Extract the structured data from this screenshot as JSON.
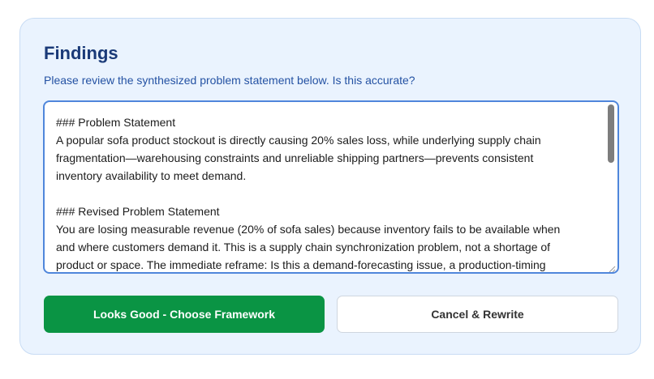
{
  "findings": {
    "title": "Findings",
    "subtitle": "Please review the synthesized problem statement below. Is this accurate?",
    "statement_lines": [
      "### Problem Statement",
      "A popular sofa product stockout is directly causing 20% sales loss, while underlying supply chain",
      "fragmentation—warehousing constraints and unreliable shipping partners—prevents consistent",
      "inventory availability to meet demand.",
      "### Revised Problem Statement",
      "You are losing measurable revenue (20% of sofa sales) because inventory fails to be available when",
      "and where customers demand it. This is a supply chain synchronization problem, not a shortage of",
      "product or space. The immediate reframe: Is this a demand-forecasting issue, a production-timing"
    ]
  },
  "actions": {
    "confirm_label": "Looks Good - Choose Framework",
    "cancel_label": "Cancel & Rewrite"
  },
  "colors": {
    "card_background": "#eaf3fe",
    "title": "#1a3a78",
    "subtitle": "#2452a3",
    "primary_button": "#0a9444",
    "focus_border": "#4f86db"
  }
}
